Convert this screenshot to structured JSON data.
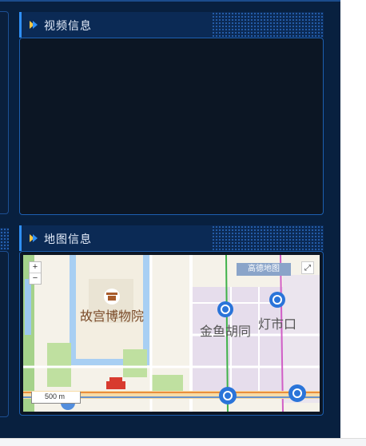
{
  "panels": {
    "video": {
      "title": "视频信息"
    },
    "map": {
      "title": "地图信息"
    }
  },
  "map": {
    "zoom_in": "+",
    "zoom_out": "−",
    "attribution": "高德地图",
    "scale": "500 m",
    "fullscreen_glyph": "⤢",
    "labels": {
      "palace": "故宫博物院",
      "jinyu": "金鱼胡同",
      "dengshi": "灯市口"
    }
  },
  "colors": {
    "background": "#08203f",
    "panel_header": "#0b2a55",
    "accent": "#2f8ff5",
    "arrow": "#f5c542",
    "metro_icon": "#2a74d9"
  }
}
